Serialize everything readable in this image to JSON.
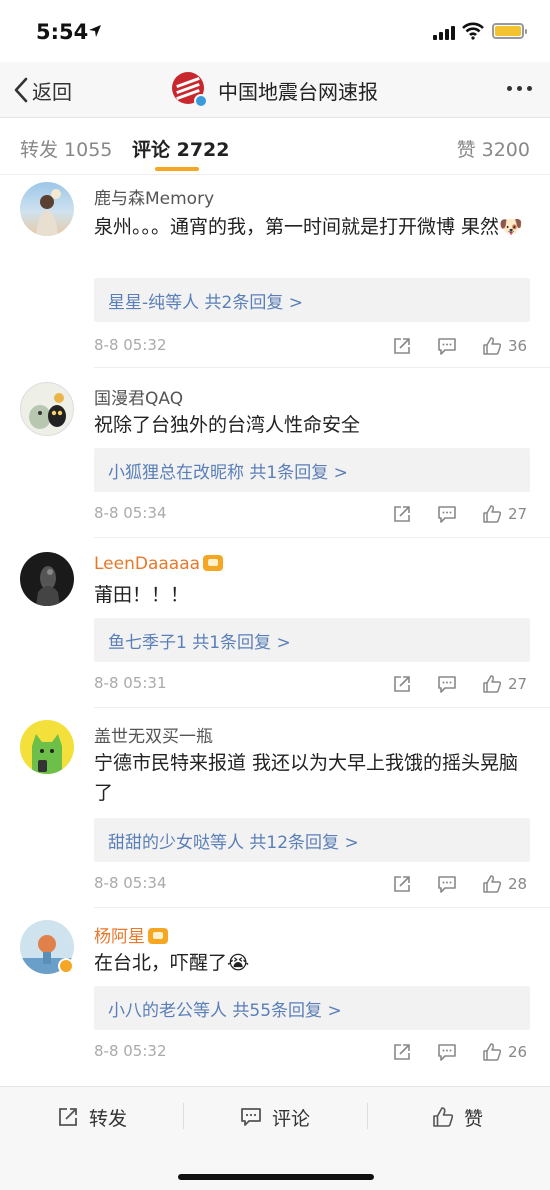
{
  "status_bar": {
    "time": "5:54"
  },
  "nav": {
    "back_label": "返回",
    "title": "中国地震台网速报"
  },
  "tabs": {
    "repost": "转发 1055",
    "comment": "评论 2722",
    "like": "赞 3200"
  },
  "comments": [
    {
      "user": "鹿与森Memory",
      "text": "泉州。。。通宵的我，第一时间就是打开微博 果然🐶",
      "replies": "星星-纯等人  共2条回复 >",
      "time": "8-8 05:32",
      "likes": "36"
    },
    {
      "user": "国漫君QAQ",
      "text": "祝除了台独外的台湾人性命安全",
      "replies": "小狐狸总在改昵称  共1条回复 >",
      "time": "8-8 05:34",
      "likes": "27"
    },
    {
      "user": "LeenDaaaaa",
      "text": "莆田！！！",
      "replies": "鱼七季子1  共1条回复 >",
      "time": "8-8 05:31",
      "likes": "27"
    },
    {
      "user": "盖世无双买一瓶",
      "text": "宁德市民特来报道 我还以为大早上我饿的摇头晃脑了",
      "replies": "甜甜的少女哒等人  共12条回复 >",
      "time": "8-8 05:34",
      "likes": "28"
    },
    {
      "user": "杨阿星",
      "text": "在台北，吓醒了😭",
      "replies": "小八的老公等人  共55条回复 >",
      "time": "8-8 05:32",
      "likes": "26"
    }
  ],
  "bottom_bar": {
    "repost": "转发",
    "comment": "评论",
    "like": "赞"
  },
  "colors": {
    "accent": "#f5a623",
    "link": "#5a7fb8",
    "vip_name": "#e8782a"
  }
}
